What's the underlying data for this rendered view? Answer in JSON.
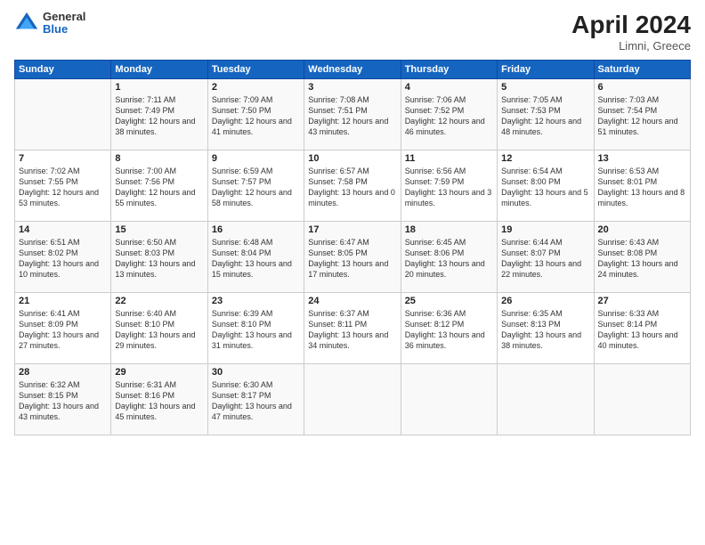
{
  "logo": {
    "general": "General",
    "blue": "Blue"
  },
  "title": {
    "month": "April 2024",
    "location": "Limni, Greece"
  },
  "header_days": [
    "Sunday",
    "Monday",
    "Tuesday",
    "Wednesday",
    "Thursday",
    "Friday",
    "Saturday"
  ],
  "weeks": [
    [
      {
        "day": "",
        "sunrise": "",
        "sunset": "",
        "daylight": ""
      },
      {
        "day": "1",
        "sunrise": "Sunrise: 7:11 AM",
        "sunset": "Sunset: 7:49 PM",
        "daylight": "Daylight: 12 hours and 38 minutes."
      },
      {
        "day": "2",
        "sunrise": "Sunrise: 7:09 AM",
        "sunset": "Sunset: 7:50 PM",
        "daylight": "Daylight: 12 hours and 41 minutes."
      },
      {
        "day": "3",
        "sunrise": "Sunrise: 7:08 AM",
        "sunset": "Sunset: 7:51 PM",
        "daylight": "Daylight: 12 hours and 43 minutes."
      },
      {
        "day": "4",
        "sunrise": "Sunrise: 7:06 AM",
        "sunset": "Sunset: 7:52 PM",
        "daylight": "Daylight: 12 hours and 46 minutes."
      },
      {
        "day": "5",
        "sunrise": "Sunrise: 7:05 AM",
        "sunset": "Sunset: 7:53 PM",
        "daylight": "Daylight: 12 hours and 48 minutes."
      },
      {
        "day": "6",
        "sunrise": "Sunrise: 7:03 AM",
        "sunset": "Sunset: 7:54 PM",
        "daylight": "Daylight: 12 hours and 51 minutes."
      }
    ],
    [
      {
        "day": "7",
        "sunrise": "Sunrise: 7:02 AM",
        "sunset": "Sunset: 7:55 PM",
        "daylight": "Daylight: 12 hours and 53 minutes."
      },
      {
        "day": "8",
        "sunrise": "Sunrise: 7:00 AM",
        "sunset": "Sunset: 7:56 PM",
        "daylight": "Daylight: 12 hours and 55 minutes."
      },
      {
        "day": "9",
        "sunrise": "Sunrise: 6:59 AM",
        "sunset": "Sunset: 7:57 PM",
        "daylight": "Daylight: 12 hours and 58 minutes."
      },
      {
        "day": "10",
        "sunrise": "Sunrise: 6:57 AM",
        "sunset": "Sunset: 7:58 PM",
        "daylight": "Daylight: 13 hours and 0 minutes."
      },
      {
        "day": "11",
        "sunrise": "Sunrise: 6:56 AM",
        "sunset": "Sunset: 7:59 PM",
        "daylight": "Daylight: 13 hours and 3 minutes."
      },
      {
        "day": "12",
        "sunrise": "Sunrise: 6:54 AM",
        "sunset": "Sunset: 8:00 PM",
        "daylight": "Daylight: 13 hours and 5 minutes."
      },
      {
        "day": "13",
        "sunrise": "Sunrise: 6:53 AM",
        "sunset": "Sunset: 8:01 PM",
        "daylight": "Daylight: 13 hours and 8 minutes."
      }
    ],
    [
      {
        "day": "14",
        "sunrise": "Sunrise: 6:51 AM",
        "sunset": "Sunset: 8:02 PM",
        "daylight": "Daylight: 13 hours and 10 minutes."
      },
      {
        "day": "15",
        "sunrise": "Sunrise: 6:50 AM",
        "sunset": "Sunset: 8:03 PM",
        "daylight": "Daylight: 13 hours and 13 minutes."
      },
      {
        "day": "16",
        "sunrise": "Sunrise: 6:48 AM",
        "sunset": "Sunset: 8:04 PM",
        "daylight": "Daylight: 13 hours and 15 minutes."
      },
      {
        "day": "17",
        "sunrise": "Sunrise: 6:47 AM",
        "sunset": "Sunset: 8:05 PM",
        "daylight": "Daylight: 13 hours and 17 minutes."
      },
      {
        "day": "18",
        "sunrise": "Sunrise: 6:45 AM",
        "sunset": "Sunset: 8:06 PM",
        "daylight": "Daylight: 13 hours and 20 minutes."
      },
      {
        "day": "19",
        "sunrise": "Sunrise: 6:44 AM",
        "sunset": "Sunset: 8:07 PM",
        "daylight": "Daylight: 13 hours and 22 minutes."
      },
      {
        "day": "20",
        "sunrise": "Sunrise: 6:43 AM",
        "sunset": "Sunset: 8:08 PM",
        "daylight": "Daylight: 13 hours and 24 minutes."
      }
    ],
    [
      {
        "day": "21",
        "sunrise": "Sunrise: 6:41 AM",
        "sunset": "Sunset: 8:09 PM",
        "daylight": "Daylight: 13 hours and 27 minutes."
      },
      {
        "day": "22",
        "sunrise": "Sunrise: 6:40 AM",
        "sunset": "Sunset: 8:10 PM",
        "daylight": "Daylight: 13 hours and 29 minutes."
      },
      {
        "day": "23",
        "sunrise": "Sunrise: 6:39 AM",
        "sunset": "Sunset: 8:10 PM",
        "daylight": "Daylight: 13 hours and 31 minutes."
      },
      {
        "day": "24",
        "sunrise": "Sunrise: 6:37 AM",
        "sunset": "Sunset: 8:11 PM",
        "daylight": "Daylight: 13 hours and 34 minutes."
      },
      {
        "day": "25",
        "sunrise": "Sunrise: 6:36 AM",
        "sunset": "Sunset: 8:12 PM",
        "daylight": "Daylight: 13 hours and 36 minutes."
      },
      {
        "day": "26",
        "sunrise": "Sunrise: 6:35 AM",
        "sunset": "Sunset: 8:13 PM",
        "daylight": "Daylight: 13 hours and 38 minutes."
      },
      {
        "day": "27",
        "sunrise": "Sunrise: 6:33 AM",
        "sunset": "Sunset: 8:14 PM",
        "daylight": "Daylight: 13 hours and 40 minutes."
      }
    ],
    [
      {
        "day": "28",
        "sunrise": "Sunrise: 6:32 AM",
        "sunset": "Sunset: 8:15 PM",
        "daylight": "Daylight: 13 hours and 43 minutes."
      },
      {
        "day": "29",
        "sunrise": "Sunrise: 6:31 AM",
        "sunset": "Sunset: 8:16 PM",
        "daylight": "Daylight: 13 hours and 45 minutes."
      },
      {
        "day": "30",
        "sunrise": "Sunrise: 6:30 AM",
        "sunset": "Sunset: 8:17 PM",
        "daylight": "Daylight: 13 hours and 47 minutes."
      },
      {
        "day": "",
        "sunrise": "",
        "sunset": "",
        "daylight": ""
      },
      {
        "day": "",
        "sunrise": "",
        "sunset": "",
        "daylight": ""
      },
      {
        "day": "",
        "sunrise": "",
        "sunset": "",
        "daylight": ""
      },
      {
        "day": "",
        "sunrise": "",
        "sunset": "",
        "daylight": ""
      }
    ]
  ]
}
